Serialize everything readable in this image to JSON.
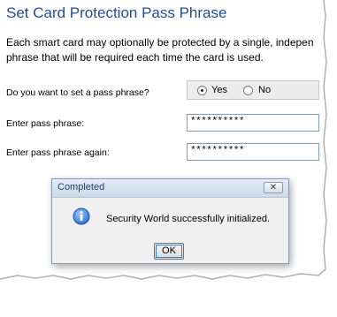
{
  "page": {
    "title": "Set Card Protection Pass Phrase",
    "description_line1": "Each smart card may optionally be protected by a single, indepen",
    "description_line2": "phrase that will be required each time the card is used."
  },
  "form": {
    "pass_phrase_question": "Do you want to set a pass phrase?",
    "yes_label": "Yes",
    "no_label": "No",
    "selected": "Yes",
    "enter_label": "Enter pass phrase:",
    "enter_value": "**********",
    "enter_again_label": "Enter pass phrase again:",
    "enter_again_value": "**********"
  },
  "dialog": {
    "title": "Completed",
    "close_label": "✕",
    "message": "Security World successfully initialized.",
    "ok_label": "OK",
    "icon": "info-icon"
  },
  "colors": {
    "title_blue": "#1f4e96",
    "dialog_background": "#f0f0f0",
    "info_icon_blue": "#2b6fd6"
  }
}
